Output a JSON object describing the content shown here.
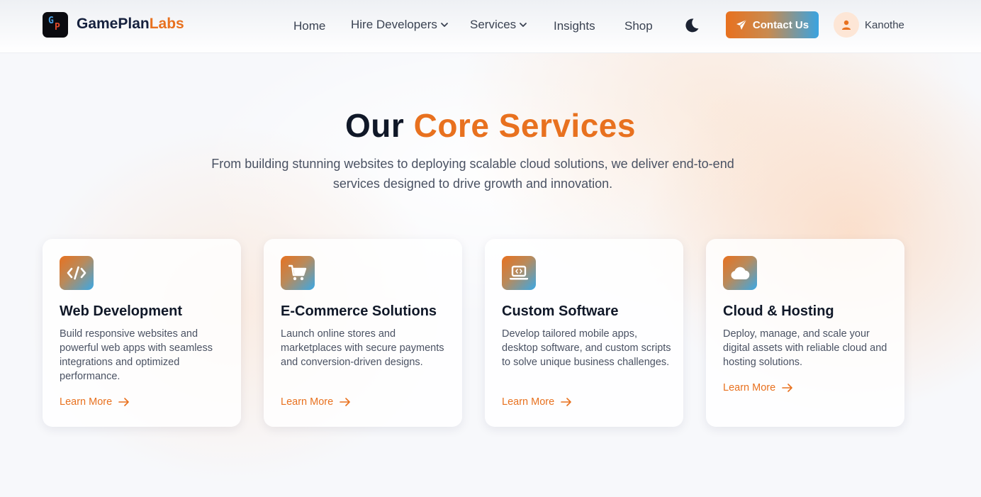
{
  "header": {
    "brand_main": "GamePlan",
    "brand_accent": "Labs",
    "logo_letters": [
      "G",
      "P"
    ],
    "nav": {
      "home": "Home",
      "hire": "Hire Developers",
      "services": "Services",
      "insights": "Insights",
      "shop": "Shop"
    },
    "contact_label": "Contact Us",
    "username": "Kanothe"
  },
  "hero": {
    "title_main": "Our",
    "title_accent": "Core Services",
    "subtitle": "From building stunning websites to deploying scalable cloud solutions, we deliver end-to-end services designed to drive growth and innovation."
  },
  "cards": [
    {
      "icon": "code-icon",
      "title": "Web Development",
      "description": "Build responsive websites and powerful web apps with seamless integrations and optimized performance.",
      "link": "Learn More"
    },
    {
      "icon": "cart-icon",
      "title": "E-Commerce Solutions",
      "description": "Launch online stores and marketplaces with secure payments and conversion-driven designs.",
      "link": "Learn More"
    },
    {
      "icon": "laptop-code-icon",
      "title": "Custom Software",
      "description": "Develop tailored mobile apps, desktop software, and custom scripts to solve unique business challenges.",
      "link": "Learn More"
    },
    {
      "icon": "cloud-icon",
      "title": "Cloud & Hosting",
      "description": "Deploy, manage, and scale your digital assets with reliable cloud and hosting solutions.",
      "link": "Learn More"
    }
  ],
  "colors": {
    "accent": "#e8711f",
    "accent_blue": "#3aa3e0",
    "heading": "#101828",
    "body": "#4a5263"
  }
}
